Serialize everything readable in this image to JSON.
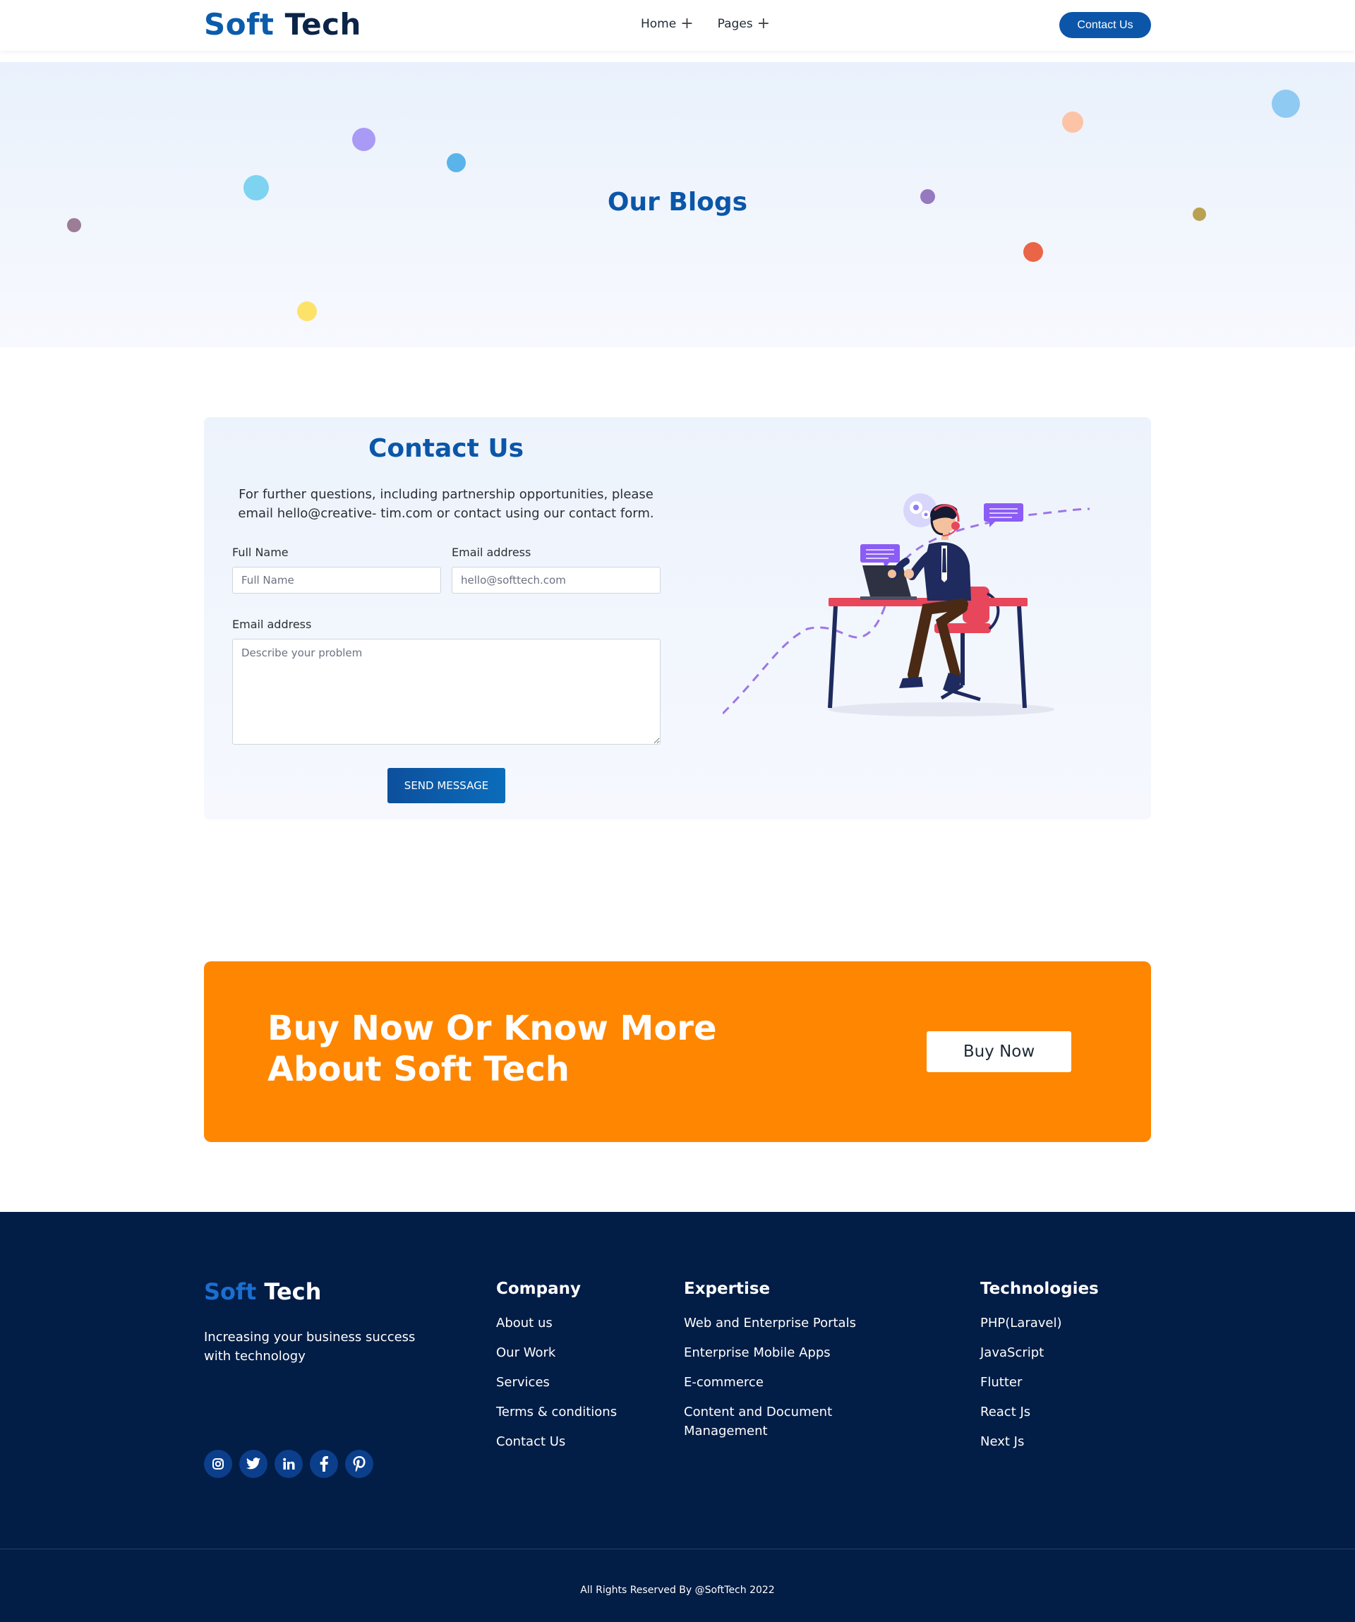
{
  "header": {
    "logo_part1": "Soft",
    "logo_part2": "Tech",
    "nav": [
      {
        "label": "Home",
        "icon": "plus-icon"
      },
      {
        "label": "Pages",
        "icon": "plus-icon"
      }
    ],
    "contact_button": "Contact Us"
  },
  "hero": {
    "title": "Our Blogs"
  },
  "contact": {
    "title": "Contact Us",
    "description": "For further questions, including partnership opportunities, please email hello@creative- tim.com or contact using our contact form.",
    "full_name_label": "Full Name",
    "full_name_placeholder": "Full Name",
    "email_label": "Email address",
    "email_placeholder": "hello@softtech.com",
    "message_label": "Email address",
    "message_placeholder": "Describe your problem",
    "send_button": "SEND MESSAGE"
  },
  "cta": {
    "title": "Buy Now Or Know More About Soft Tech",
    "button": "Buy Now"
  },
  "footer": {
    "logo_part1": "Soft",
    "logo_part2": "Tech",
    "tagline": "Increasing your business success with technology",
    "socials": [
      "instagram-icon",
      "twitter-icon",
      "linkedin-icon",
      "facebook-icon",
      "pinterest-icon"
    ],
    "company": {
      "heading": "Company",
      "links": [
        "About us",
        "Our Work",
        "Services",
        "Terms & conditions",
        "Contact Us"
      ]
    },
    "expertise": {
      "heading": "Expertise",
      "links": [
        "Web and Enterprise Portals",
        "Enterprise Mobile Apps",
        "E-commerce",
        "Content and Document Management"
      ]
    },
    "technologies": {
      "heading": "Technologies",
      "links": [
        "PHP(Laravel)",
        "JavaScript",
        "Flutter",
        "React Js",
        "Next Js"
      ]
    },
    "copyright": "All Rights Reserved By @SoftTech 2022"
  },
  "colors": {
    "brand_blue": "#0b56a8",
    "cta_orange": "#ff8600",
    "footer_navy": "#021d46"
  }
}
